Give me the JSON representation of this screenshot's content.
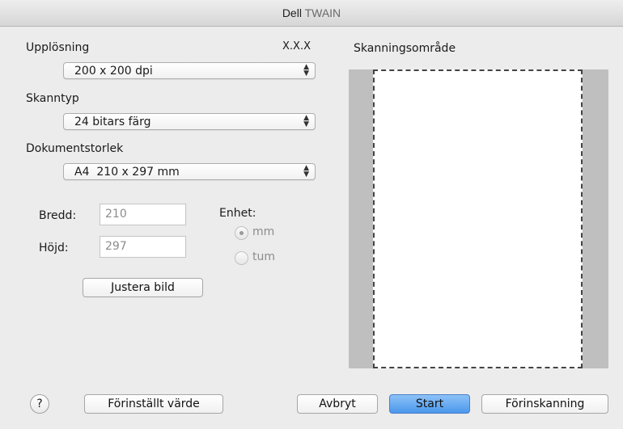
{
  "window": {
    "title_part1": "Dell ",
    "title_part2": "TWAIN"
  },
  "version": "X.X.X",
  "resolution": {
    "label": "Upplösning",
    "value": "200 x 200 dpi"
  },
  "scan_type": {
    "label": "Skanntyp",
    "value": "24 bitars färg"
  },
  "document_size": {
    "label": "Dokumentstorlek",
    "value": "A4  210 x 297 mm"
  },
  "width": {
    "label": "Bredd:",
    "value": "210"
  },
  "height": {
    "label": "Höjd:",
    "value": "297"
  },
  "unit": {
    "label": "Enhet:",
    "options": [
      "mm",
      "tum"
    ],
    "selected": "mm"
  },
  "adjust_button": "Justera bild",
  "scan_area_label": "Skanningsområde",
  "footer": {
    "help": "?",
    "default": "Förinställt värde",
    "cancel": "Avbryt",
    "start": "Start",
    "prescan": "Förinskanning"
  }
}
